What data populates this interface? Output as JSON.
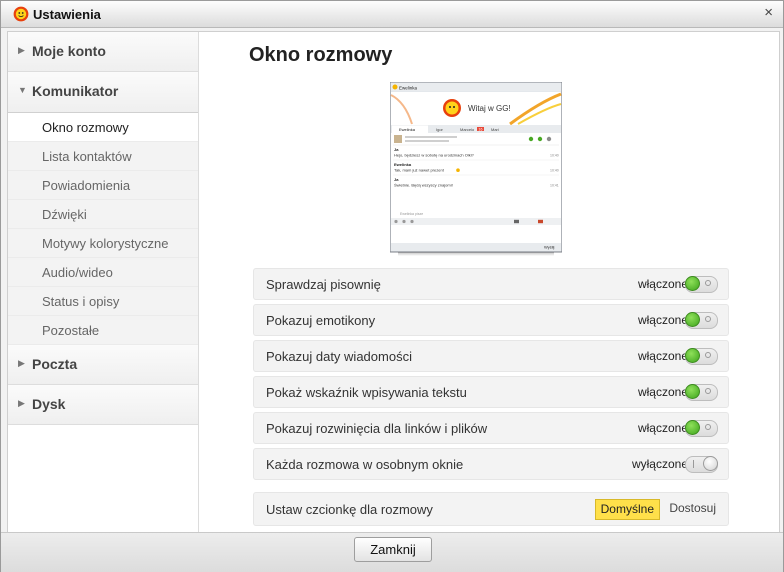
{
  "window": {
    "title": "Ustawienia",
    "close_glyph": "×",
    "icon": "gg-sun-icon"
  },
  "sidebar": {
    "sections": [
      {
        "label": "Moje konto",
        "expanded": false
      },
      {
        "label": "Komunikator",
        "expanded": true
      },
      {
        "label": "Poczta",
        "expanded": false
      },
      {
        "label": "Dysk",
        "expanded": false
      }
    ],
    "komunikator_items": [
      {
        "label": "Okno rozmowy",
        "active": true
      },
      {
        "label": "Lista kontaktów",
        "active": false
      },
      {
        "label": "Powiadomienia",
        "active": false
      },
      {
        "label": "Dźwięki",
        "active": false
      },
      {
        "label": "Motywy kolorystyczne",
        "active": false
      },
      {
        "label": "Audio/wideo",
        "active": false
      },
      {
        "label": "Status i opisy",
        "active": false
      },
      {
        "label": "Pozostałe",
        "active": false
      }
    ]
  },
  "main": {
    "title": "Okno rozmowy",
    "preview": {
      "contact": "Ewelinka",
      "banner": "Witaj w GG!",
      "tabs": [
        "Ewelinka",
        "Igor",
        "Marcelo",
        "Mari"
      ],
      "tab_badge": "16",
      "messages": [
        {
          "from": "Ja",
          "text": "Hejo, będziesz w sobotę na urodzinach Olki?",
          "time": "10:40"
        },
        {
          "from": "Ewelinka",
          "text": "Tak, mam już nawet prezent",
          "time": "10:40"
        },
        {
          "from": "Ja",
          "text": "Świetnie. Będą wszyscy znajomi!",
          "time": "10:41"
        }
      ],
      "input_placeholder": "Ewelinka pisze",
      "send_label": "Wyślij",
      "typing_label": "Ewelinka pisze"
    },
    "settings": [
      {
        "label": "Sprawdzaj pisownię",
        "state": "włączone",
        "on": true
      },
      {
        "label": "Pokazuj emotikony",
        "state": "włączone",
        "on": true
      },
      {
        "label": "Pokazuj daty wiadomości",
        "state": "włączone",
        "on": true
      },
      {
        "label": "Pokaż wskaźnik wpisywania tekstu",
        "state": "włączone",
        "on": true
      },
      {
        "label": "Pokazuj rozwinięcia dla linków i plików",
        "state": "włączone",
        "on": true
      },
      {
        "label": "Każda rozmowa w osobnym oknie",
        "state": "wyłączone",
        "on": false
      }
    ],
    "font": {
      "label": "Ustaw czcionkę dla rozmowy",
      "default_label": "Domyślne",
      "custom_label": "Dostosuj"
    }
  },
  "footer": {
    "close_label": "Zamknij"
  },
  "colors": {
    "accent_yellow": "#ffe04a",
    "toggle_on": "#3ea51c"
  }
}
